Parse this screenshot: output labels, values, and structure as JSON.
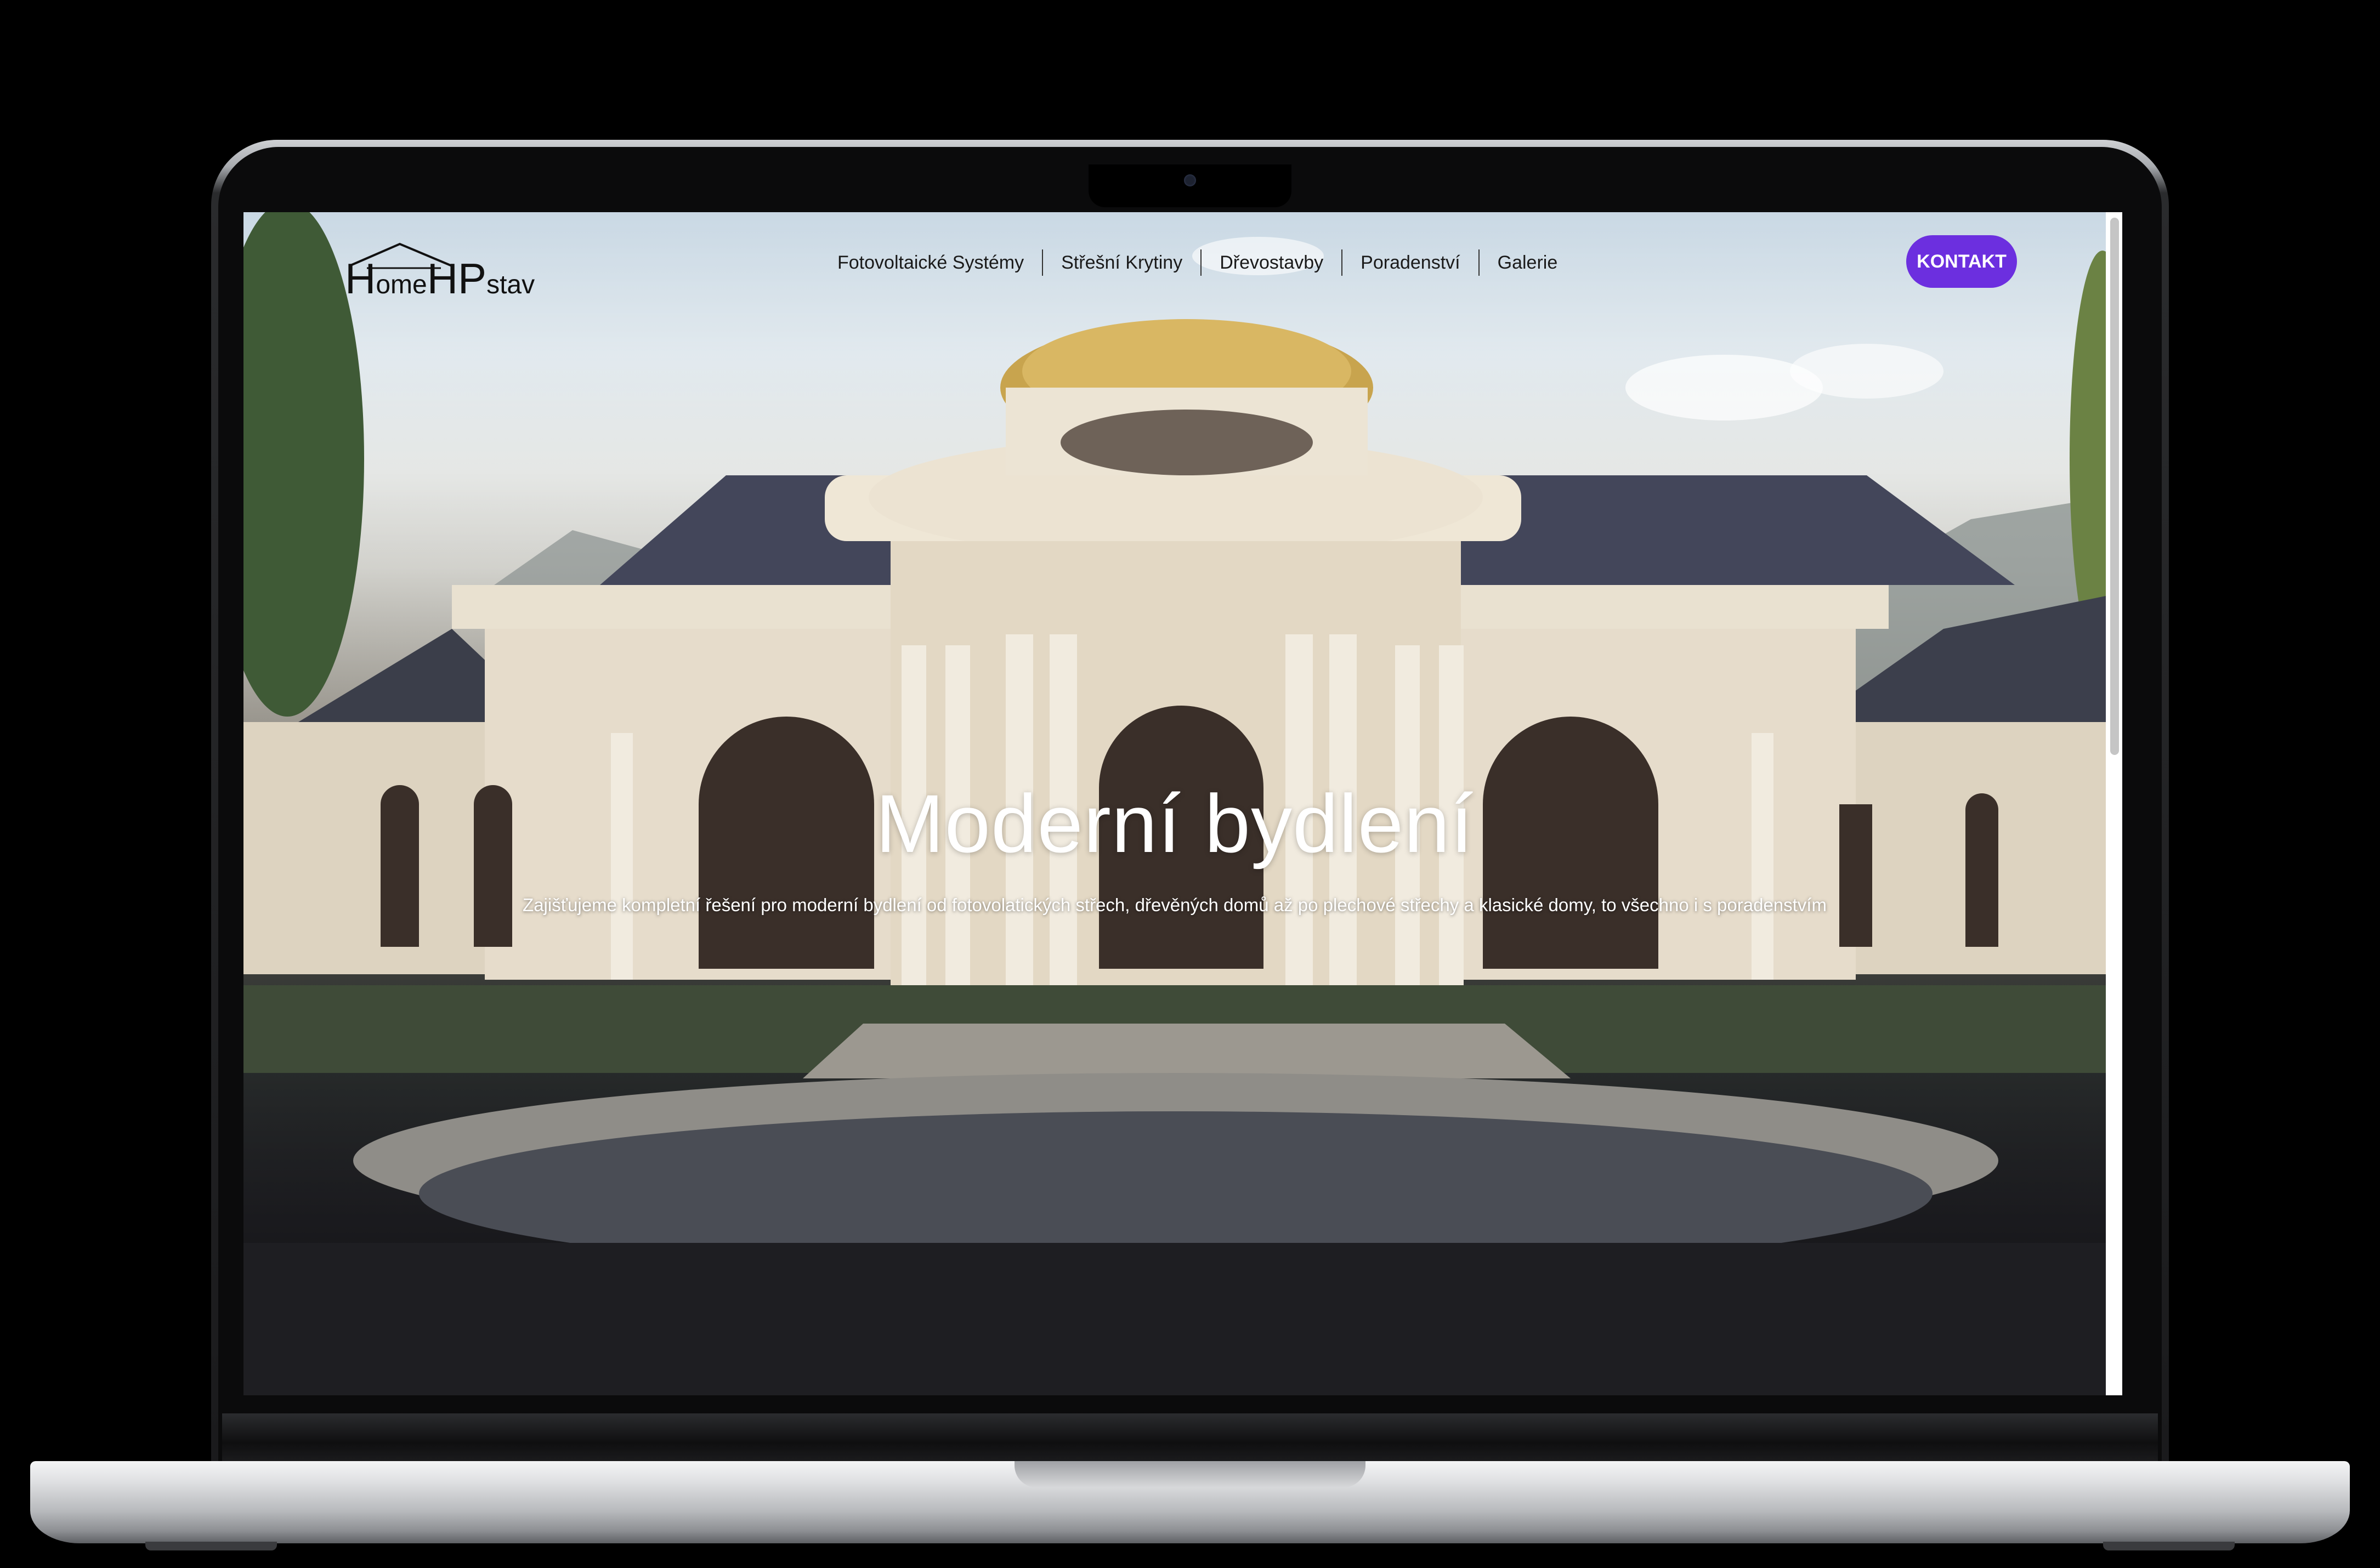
{
  "header": {
    "logo": {
      "part1": "H",
      "part2": "ome",
      "part3": "HP",
      "part4": "stav"
    },
    "nav": [
      {
        "label": "Fotovoltaické Systémy"
      },
      {
        "label": "Střešní Krytiny"
      },
      {
        "label": "Dřevostavby"
      },
      {
        "label": "Poradenství"
      },
      {
        "label": "Galerie"
      }
    ],
    "cta_label": "KONTAKT"
  },
  "hero": {
    "title": "Moderní bydlení",
    "subtitle": "Zajišťujeme kompletní řešení pro moderní bydlení od fotovolatických střech, dřevěných domů až po plechové střechy a klasické domy, to všechno i s poradenstvím"
  },
  "colors": {
    "accent": "#6c2fdf",
    "text_dark": "#1a1a1a",
    "hero_text": "#ffffff"
  }
}
